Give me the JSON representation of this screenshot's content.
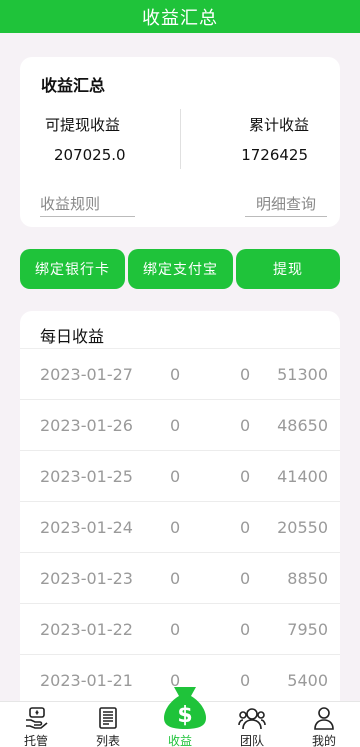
{
  "header": {
    "title": "收益汇总"
  },
  "summary": {
    "title": "收益汇总",
    "withdrawable_label": "可提现收益",
    "withdrawable_value": "207025.0",
    "cumulative_label": "累计收益",
    "cumulative_value": "1726425",
    "rules_link": "收益规则",
    "detail_link": "明细查询"
  },
  "actions": {
    "bind_bank": "绑定银行卡",
    "bind_alipay": "绑定支付宝",
    "withdraw": "提现"
  },
  "daily": {
    "title": "每日收益",
    "rows": [
      {
        "date": "2023-01-27",
        "a": "0",
        "b": "0",
        "total": "51300"
      },
      {
        "date": "2023-01-26",
        "a": "0",
        "b": "0",
        "total": "48650"
      },
      {
        "date": "2023-01-25",
        "a": "0",
        "b": "0",
        "total": "41400"
      },
      {
        "date": "2023-01-24",
        "a": "0",
        "b": "0",
        "total": "20550"
      },
      {
        "date": "2023-01-23",
        "a": "0",
        "b": "0",
        "total": "8850"
      },
      {
        "date": "2023-01-22",
        "a": "0",
        "b": "0",
        "total": "7950"
      },
      {
        "date": "2023-01-21",
        "a": "0",
        "b": "0",
        "total": "5400"
      }
    ]
  },
  "nav": {
    "items": [
      {
        "label": "托管",
        "icon": "hand-money-icon"
      },
      {
        "label": "列表",
        "icon": "list-doc-icon"
      },
      {
        "label": "收益",
        "icon": "money-bag-icon"
      },
      {
        "label": "团队",
        "icon": "team-icon"
      },
      {
        "label": "我的",
        "icon": "user-icon"
      }
    ],
    "active": "收益"
  },
  "colors": {
    "accent": "#1fc33a",
    "background": "#f6f2f6"
  }
}
